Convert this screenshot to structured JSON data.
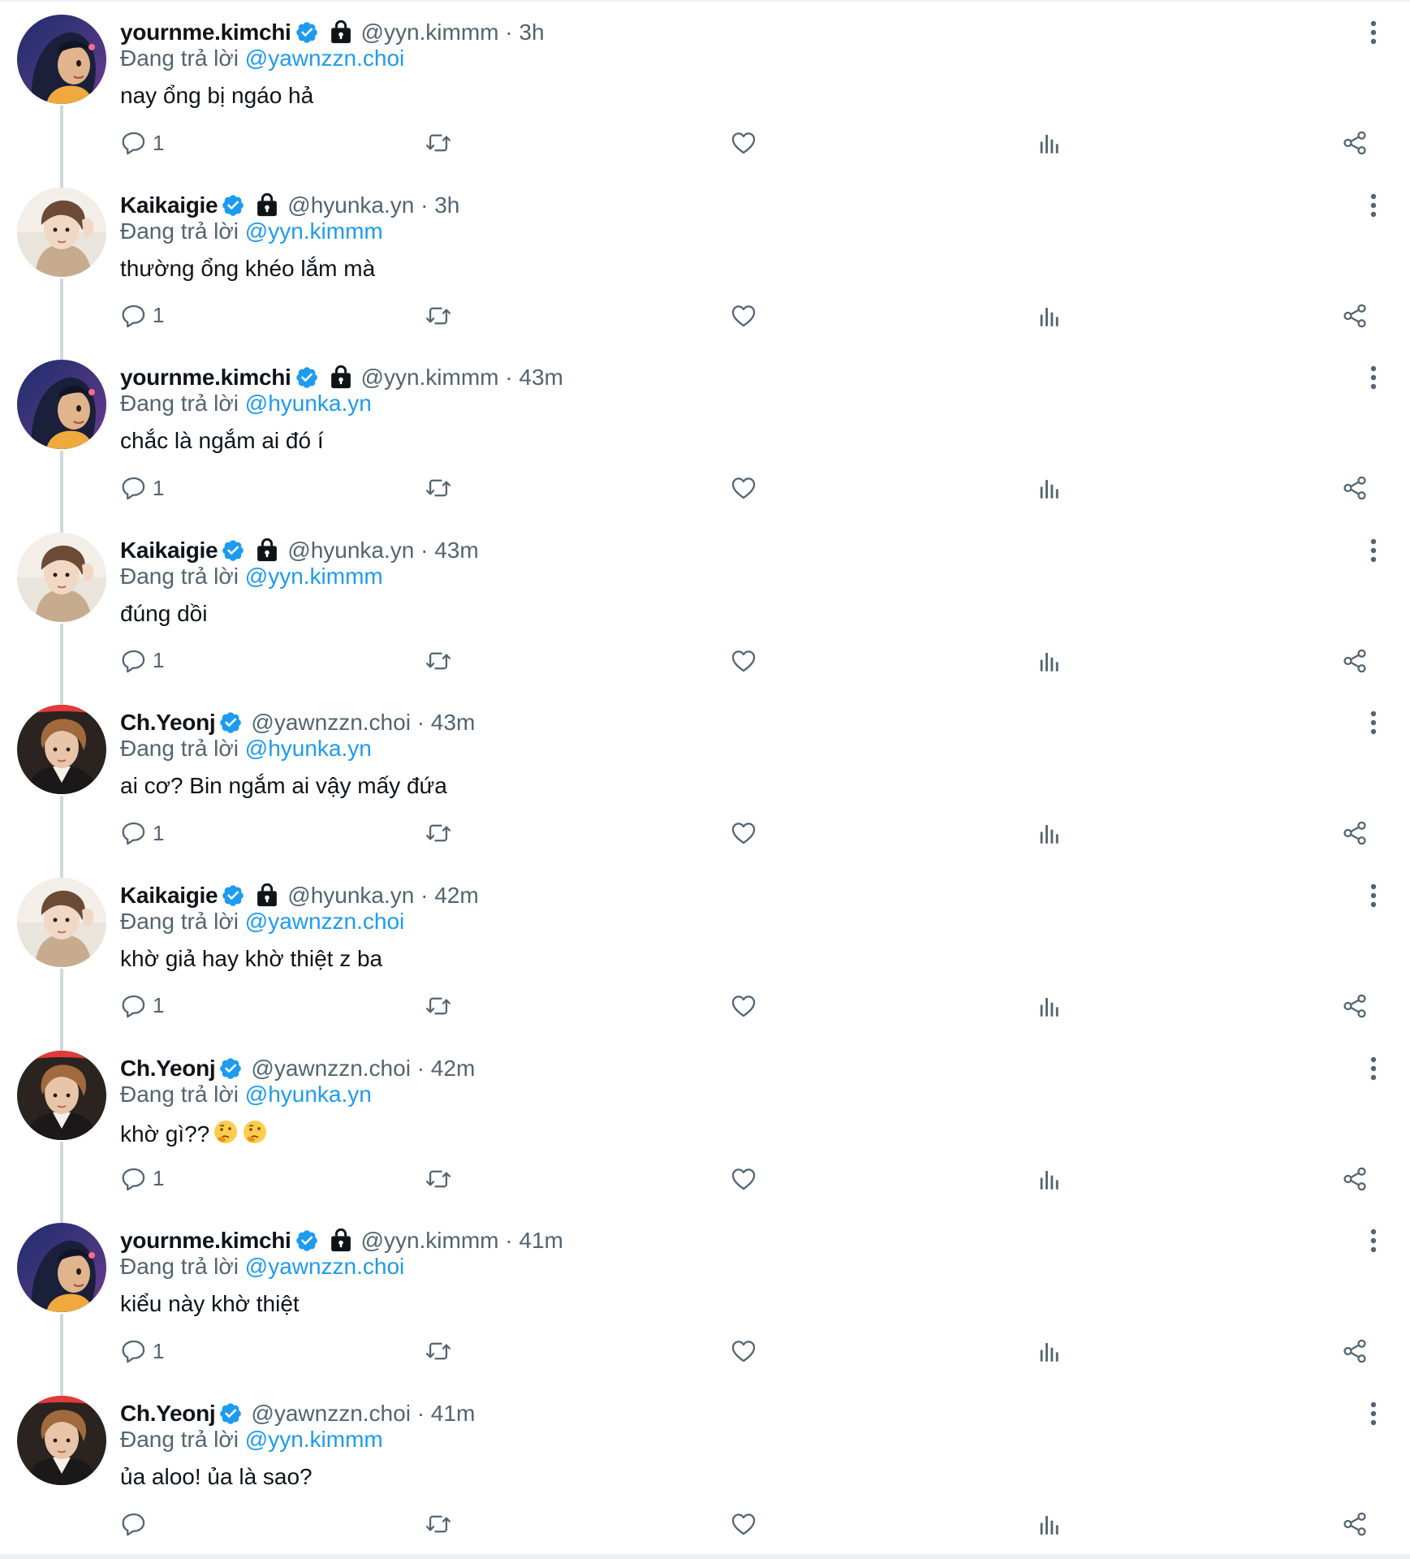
{
  "reply_prefix": "Đang trả lời",
  "icons": {
    "reply": "reply-icon",
    "retweet": "retweet-icon",
    "like": "heart-icon",
    "views": "views-icon",
    "share": "share-icon",
    "more": "more-options-icon",
    "verified": "verified-badge-icon",
    "lock": "lock-icon"
  },
  "colors": {
    "link": "#1d9bf0",
    "secondary_text": "#536471",
    "primary_text": "#0f1419",
    "verified": "#1d9bf0",
    "thread_line": "#cfd9de"
  },
  "tweets": [
    {
      "name": "yournme.kimchi",
      "locked": true,
      "handle": "@yyn.kimmm · 3h",
      "reply_to": "@yawnzzn.choi",
      "text": "nay ổng bị ngáo hả",
      "replies": "1",
      "avatar": "cartoon-girl"
    },
    {
      "name": "Kaikaigie",
      "locked": true,
      "handle": "@hyunka.yn · 3h",
      "reply_to": "@yyn.kimmm",
      "text": "thường ổng khéo lắm mà",
      "replies": "1",
      "avatar": "boy-light"
    },
    {
      "name": "yournme.kimchi",
      "locked": true,
      "handle": "@yyn.kimmm · 43m",
      "reply_to": "@hyunka.yn",
      "text": "chắc là ngắm ai đó í",
      "replies": "1",
      "avatar": "cartoon-girl"
    },
    {
      "name": "Kaikaigie",
      "locked": true,
      "handle": "@hyunka.yn · 43m",
      "reply_to": "@yyn.kimmm",
      "text": "đúng dồi",
      "replies": "1",
      "avatar": "boy-light"
    },
    {
      "name": "Ch.Yeonj",
      "locked": false,
      "handle": "@yawnzzn.choi · 43m",
      "reply_to": "@hyunka.yn",
      "text": "ai cơ? Bin ngắm ai vậy mấy đứa",
      "replies": "1",
      "avatar": "boy-dark"
    },
    {
      "name": "Kaikaigie",
      "locked": true,
      "handle": "@hyunka.yn · 42m",
      "reply_to": "@yawnzzn.choi",
      "text": "khờ giả hay khờ thiệt z ba",
      "replies": "1",
      "avatar": "boy-light"
    },
    {
      "name": "Ch.Yeonj",
      "locked": false,
      "handle": "@yawnzzn.choi · 42m",
      "reply_to": "@hyunka.yn",
      "text": "khờ gì??",
      "emoji": [
        "thinking-face-emoji",
        "thinking-face-emoji"
      ],
      "replies": "1",
      "avatar": "boy-dark"
    },
    {
      "name": "yournme.kimchi",
      "locked": true,
      "handle": "@yyn.kimmm · 41m",
      "reply_to": "@yawnzzn.choi",
      "text": "kiểu này khờ thiệt",
      "replies": "1",
      "avatar": "cartoon-girl"
    },
    {
      "name": "Ch.Yeonj",
      "locked": false,
      "handle": "@yawnzzn.choi · 41m",
      "reply_to": "@yyn.kimmm",
      "text": "ủa aloo! ủa là sao?",
      "replies": "",
      "avatar": "boy-dark"
    }
  ]
}
